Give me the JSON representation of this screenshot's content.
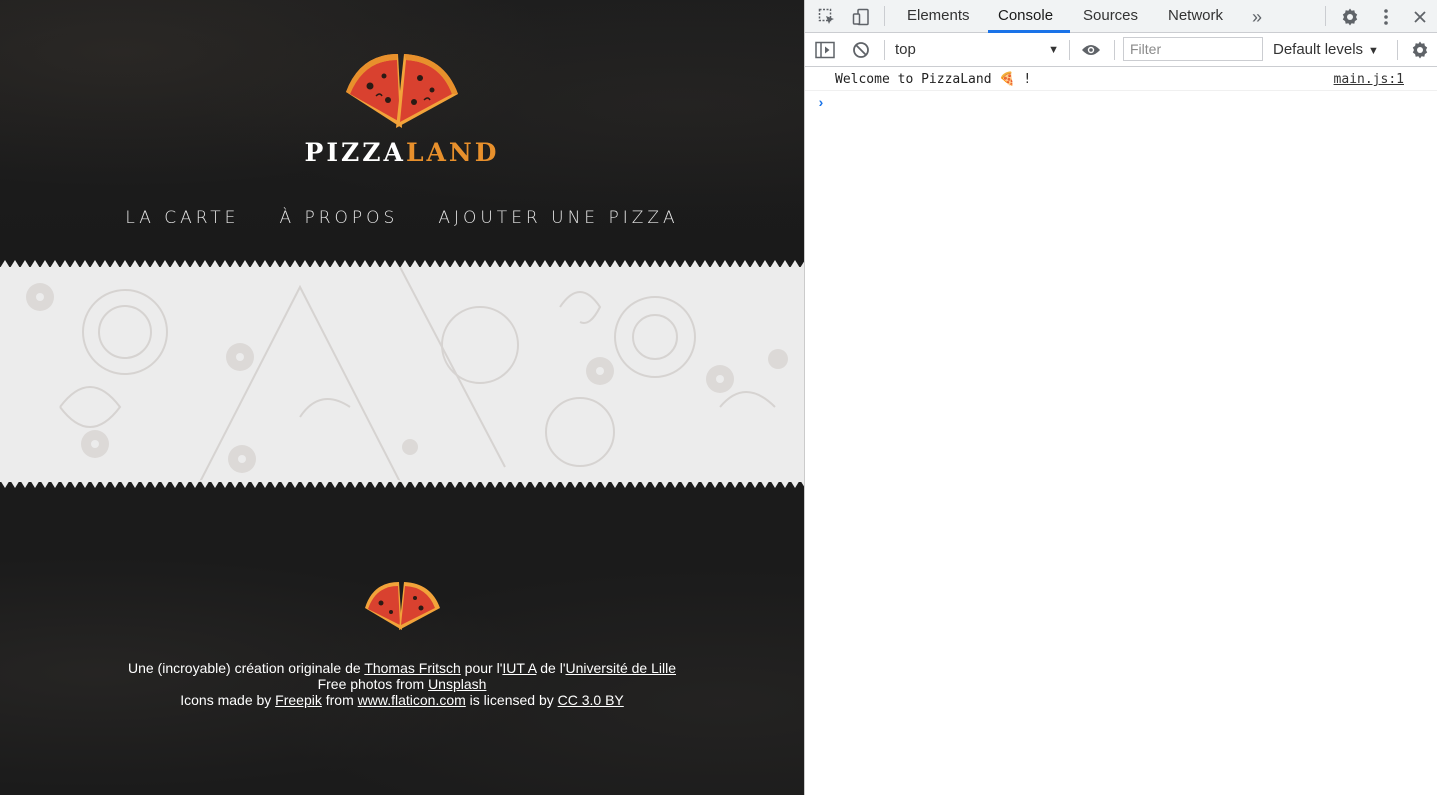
{
  "site": {
    "title_part1": "PIZZA",
    "title_part2": "LAND",
    "nav": [
      "LA CARTE",
      "À PROPOS",
      "AJOUTER UNE PIZZA"
    ],
    "footer": {
      "line1_prefix": "Une (incroyable) création originale de ",
      "author": "Thomas Fritsch",
      "line1_mid1": " pour l'",
      "school": "IUT A",
      "line1_mid2": " de l'",
      "university": "Université de Lille",
      "line2_prefix": "Free photos from ",
      "photos_link": "Unsplash",
      "line3_prefix": "Icons made by ",
      "icons_author": "Freepik",
      "line3_mid1": " from ",
      "icons_site": "www.flaticon.com",
      "line3_mid2": " is licensed by ",
      "license": "CC 3.0 BY"
    },
    "colors": {
      "accent": "#e8902c",
      "background": "#1b1b1b",
      "band": "#ececec"
    }
  },
  "devtools": {
    "tabs": [
      "Elements",
      "Console",
      "Sources",
      "Network"
    ],
    "active_tab": "Console",
    "more_tabs_glyph": "»",
    "context": "top",
    "filter_placeholder": "Filter",
    "levels": "Default levels",
    "log": {
      "message": "Welcome to PizzaLand 🍕 !",
      "source": "main.js:1"
    },
    "prompt_glyph": "›",
    "accent": "#1a73e8"
  }
}
